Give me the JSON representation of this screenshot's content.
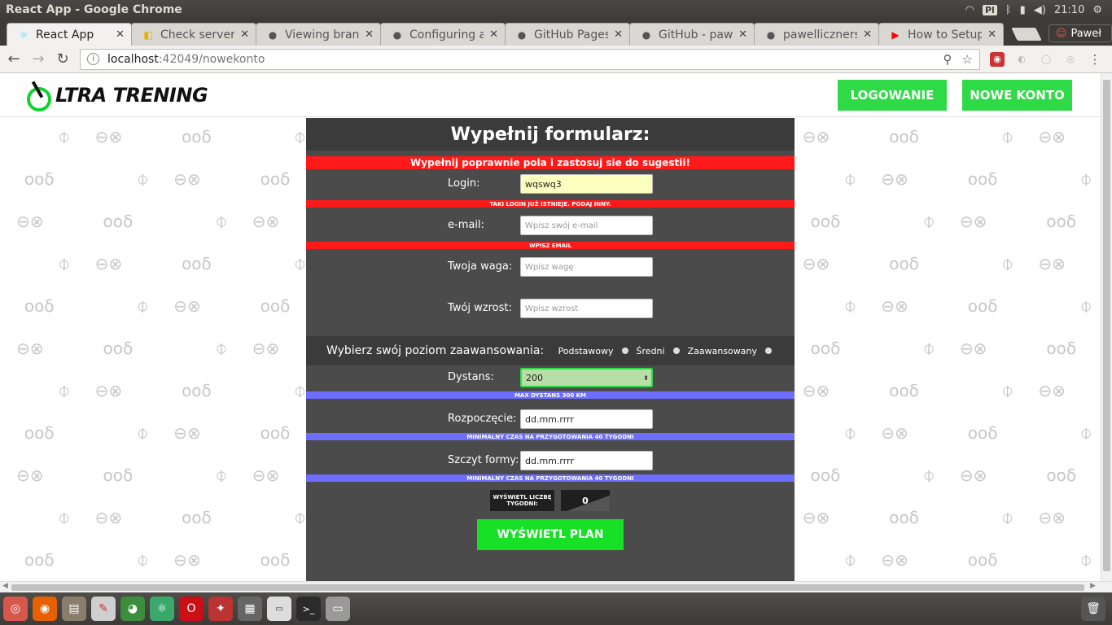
{
  "os": {
    "window_title": "React App - Google Chrome",
    "keyboard_layout": "Pl",
    "clock": "21:10",
    "user": "Paweł"
  },
  "browser": {
    "tabs": [
      {
        "label": "React App",
        "favicon": "react-icon",
        "color": "#222222"
      },
      {
        "label": "Check server",
        "favicon": "codeship-icon",
        "color": "#e4b000"
      },
      {
        "label": "Viewing bran",
        "favicon": "github-icon",
        "color": "#222222"
      },
      {
        "label": "Configuring a",
        "favicon": "github-icon",
        "color": "#222222"
      },
      {
        "label": "GitHub Pages",
        "favicon": "github-icon",
        "color": "#222222"
      },
      {
        "label": "GitHub - pawe",
        "favicon": "github-icon",
        "color": "#222222"
      },
      {
        "label": "pawelliczners",
        "favicon": "github-icon",
        "color": "#222222"
      },
      {
        "label": "How to Setup",
        "favicon": "youtube-icon",
        "color": "#ff0000"
      }
    ],
    "url_host": "localhost",
    "url_path": ":42049/nowekonto"
  },
  "site": {
    "logo_text": "LTRA TRENING",
    "nav": {
      "login": "LOGOWANIE",
      "new_account": "NOWE KONTO"
    },
    "colors": {
      "brand_green": "#2fda47",
      "error_red": "#ff1a1a",
      "hint_blue": "#6d6dff"
    }
  },
  "form": {
    "title": "Wypełnij formularz:",
    "error_banner": "Wypełnij poprawnie pola i zastosuj sie do sugestii!",
    "login": {
      "label": "Login:",
      "value": "wqswq3",
      "error": "TAKI LOGIN JUŻ ISTNIEJE. PODAJ INNY."
    },
    "email": {
      "label": "e-mail:",
      "placeholder": "Wpisz swój e-mail",
      "error": "WPISZ EMAIL"
    },
    "weight": {
      "label": "Twoja waga:",
      "placeholder": "Wpisz wagę"
    },
    "height": {
      "label": "Twój wzrost:",
      "placeholder": "Wpisz wzrost"
    },
    "level": {
      "label": "Wybierz swój poziom zaawansowania:",
      "options": [
        "Podstawowy",
        "Średni",
        "Zaawansowany"
      ]
    },
    "distance": {
      "label": "Dystans:",
      "value": "200",
      "hint": "MAX DYSTANS 300 KM"
    },
    "start": {
      "label": "Rozpoczęcie:",
      "value": "dd.mm.rrrr",
      "hint": "MINIMALNY CZAS NA PRZYGOTOWANIA 40 TYGODNI"
    },
    "peak": {
      "label": "Szczyt formy:",
      "value": "dd.mm.rrrr",
      "hint": "MINIMALNY CZAS NA PRZYGOTOWANIA 40 TYGODNI"
    },
    "weeks": {
      "label": "WYŚWIETL LICZBĘ TYGODNI:",
      "value": "0"
    },
    "submit": "WYŚWIETL PLAN"
  }
}
